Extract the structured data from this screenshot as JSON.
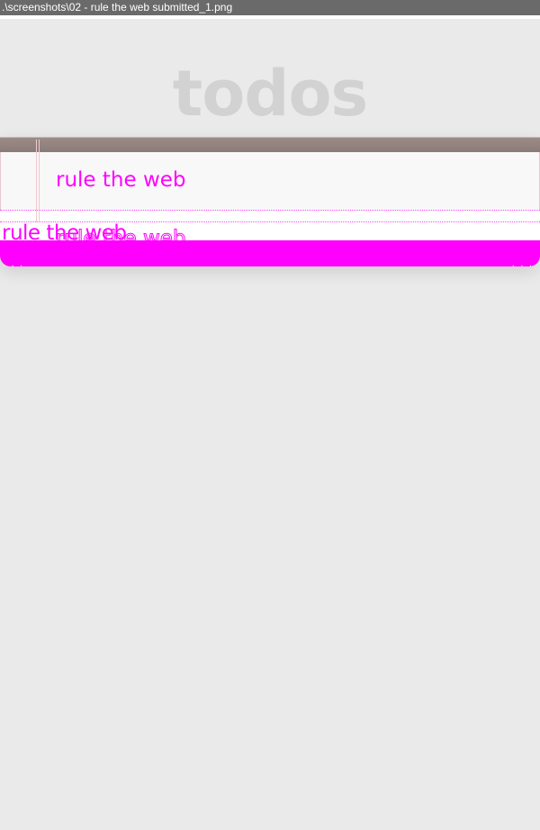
{
  "window": {
    "title": ".\\screenshots\\02 - rule the web submitted_1.png"
  },
  "app": {
    "title": "todos"
  },
  "new_todo": {
    "value": "rule the web"
  },
  "todos": [
    {
      "label": "rule the web",
      "overlay_label": "rule the web"
    }
  ],
  "colors": {
    "accent": "#ff00ff",
    "title": "#d2d2d2",
    "header_bar": "#8a7c78",
    "background": "#eaeaea"
  }
}
